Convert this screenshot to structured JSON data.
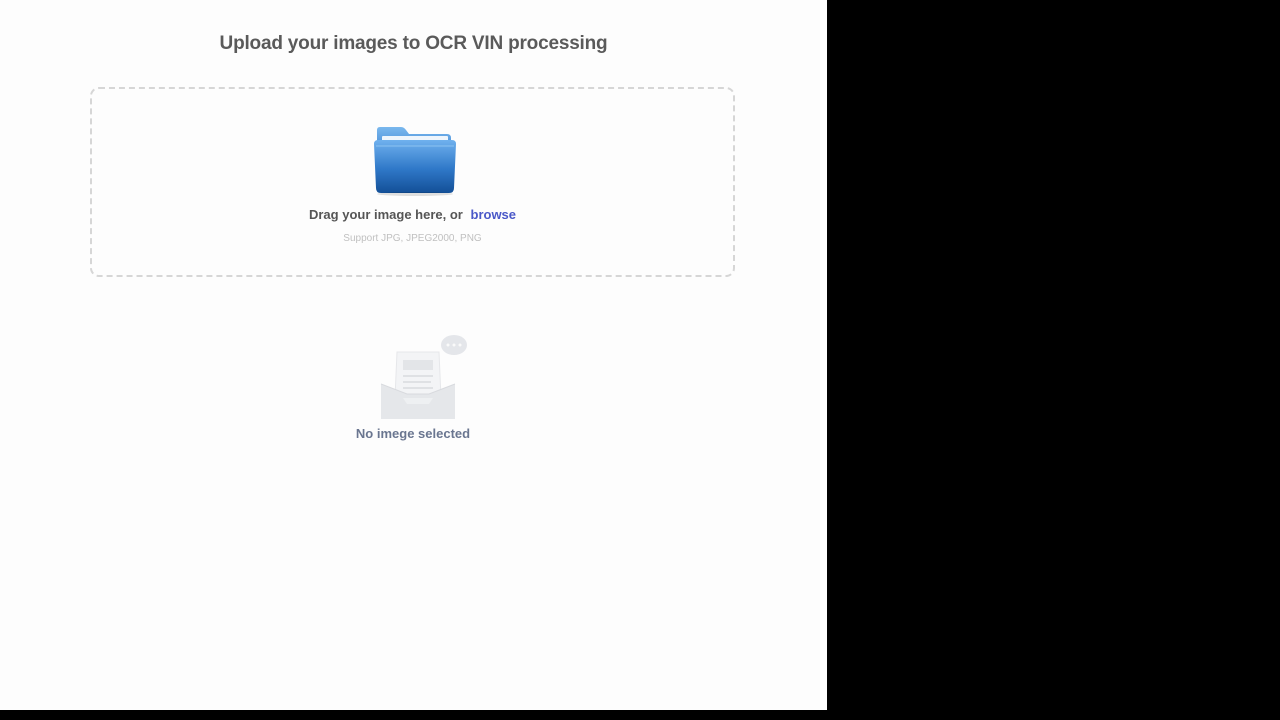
{
  "page": {
    "title": "Upload your images to OCR VIN processing"
  },
  "dropzone": {
    "icon": "folder-icon",
    "drag_text": "Drag your image here, or",
    "browse_label": "browse",
    "support_text": "Support JPG, JPEG2000, PNG",
    "accent_color": "#4a58c8"
  },
  "empty_state": {
    "icon": "empty-inbox-icon",
    "label": "No imege selected"
  }
}
